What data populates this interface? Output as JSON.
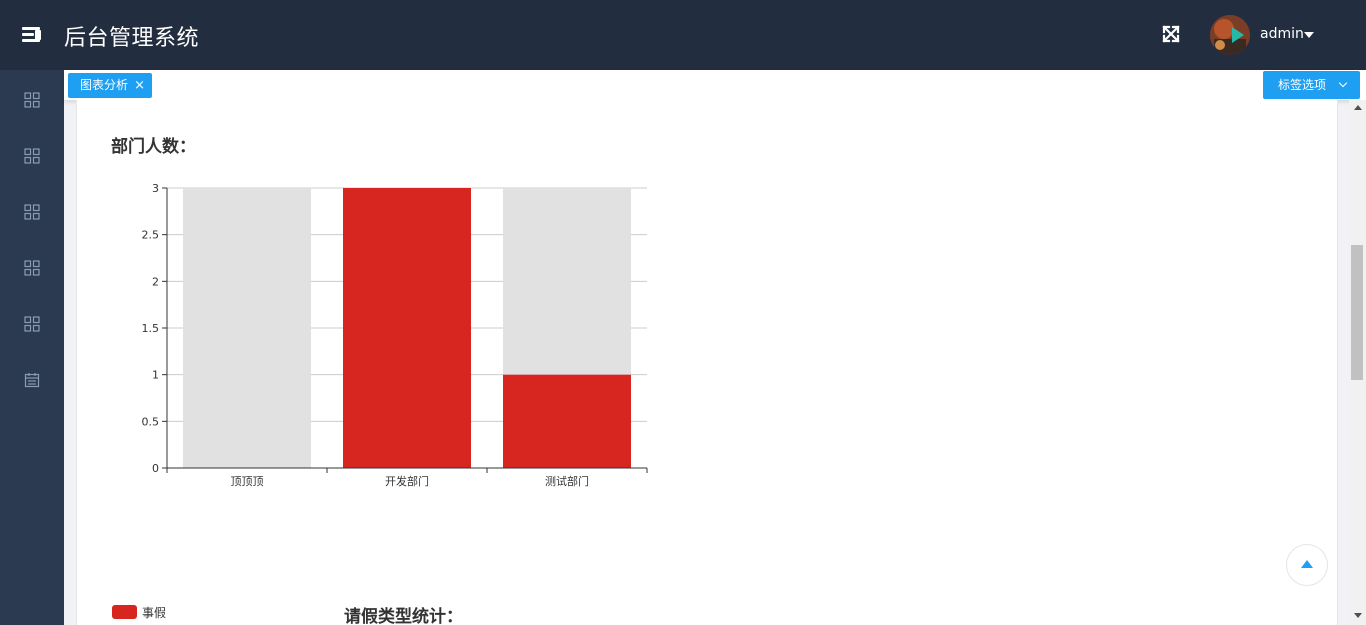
{
  "header": {
    "title": "后台管理系统",
    "user": "admin"
  },
  "sidebar": {
    "items": [
      {
        "icon": "grid-icon"
      },
      {
        "icon": "grid-icon"
      },
      {
        "icon": "grid-icon"
      },
      {
        "icon": "grid-icon"
      },
      {
        "icon": "grid-icon"
      },
      {
        "icon": "calendar-icon"
      }
    ]
  },
  "tabs": {
    "items": [
      {
        "label": "图表分析",
        "close": "×"
      }
    ],
    "options_label": "标签选项"
  },
  "section1": {
    "title": "部门人数："
  },
  "section2": {
    "title": "请假类型统计："
  },
  "chart_data": {
    "type": "bar",
    "title": "",
    "xlabel": "",
    "ylabel": "",
    "categories": [
      "顶顶顶",
      "开发部门",
      "测试部门"
    ],
    "ylim": [
      0,
      3
    ],
    "yticks": [
      0,
      0.5,
      1,
      1.5,
      2,
      2.5,
      3
    ],
    "ytick_labels": [
      "0",
      "0.5",
      "1",
      "1.5",
      "2",
      "2.5",
      "3"
    ],
    "background_values": [
      3,
      3,
      3
    ],
    "series": [
      {
        "name": "事假",
        "color": "#d7261f",
        "values": [
          0,
          3,
          1
        ]
      }
    ],
    "background_color": "#e1e1e1",
    "grid": true,
    "legend": "bottom-left"
  },
  "colors": {
    "header_bg": "#222d3f",
    "sidebar_bg": "#2b3a50",
    "accent": "#1e9ff2"
  }
}
